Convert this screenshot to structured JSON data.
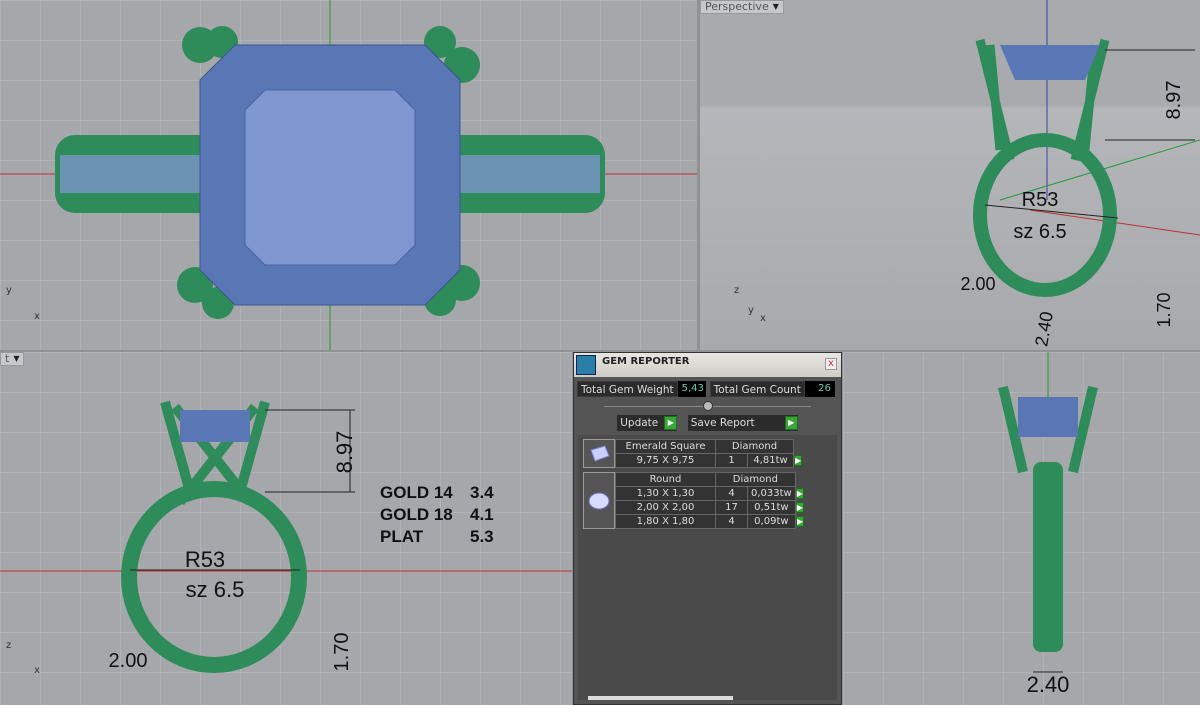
{
  "viewports": {
    "top": {
      "axis_x": "x",
      "axis_y": "y"
    },
    "perspective": {
      "label": "Perspective",
      "dims": {
        "height": "8.97",
        "ring_size": "R53",
        "sz": "sz 6.5",
        "shank_left": "2.00",
        "bottom": "2.40",
        "side": "1.70"
      },
      "axis_x": "x",
      "axis_y": "y",
      "axis_z": "z"
    },
    "front": {
      "label": "t",
      "dims": {
        "height": "8.97",
        "ring_size": "R53",
        "sz": "sz 6.5",
        "shank_left": "2.00",
        "side": "1.70"
      },
      "axis_x": "x",
      "axis_z": "z",
      "metals": [
        {
          "name": "GOLD  14",
          "weight": "3.4"
        },
        {
          "name": "GOLD  18",
          "weight": "4.1"
        },
        {
          "name": "PLAT",
          "weight": "5.3"
        }
      ]
    },
    "right": {
      "dims": {
        "bottom": "2.40"
      }
    }
  },
  "gem_reporter": {
    "title": "GEM REPORTER",
    "close": "x",
    "total_weight_label": "Total Gem Weight",
    "total_weight": "5,43",
    "total_count_label": "Total Gem Count",
    "total_count": "26",
    "update_label": "Update",
    "save_label": "Save Report",
    "groups": [
      {
        "shape": "Emerald Square",
        "material": "Diamond",
        "icon": "emerald-gem-icon",
        "rows": [
          {
            "size": "9,75 X 9,75",
            "count": "1",
            "weight": "4,81tw"
          }
        ]
      },
      {
        "shape": "Round",
        "material": "Diamond",
        "icon": "round-gem-icon",
        "rows": [
          {
            "size": "1,30 X 1,30",
            "count": "4",
            "weight": "0,033tw"
          },
          {
            "size": "2,00 X 2,00",
            "count": "17",
            "weight": "0,51tw"
          },
          {
            "size": "1,80 X 1,80",
            "count": "4",
            "weight": "0,09tw"
          }
        ]
      }
    ],
    "colors": {
      "ring_metal": "#2e8b5a",
      "gem": "#6d86c0",
      "panel": "#545454",
      "value_text": "#6ec9b0",
      "button_go": "#3aa63a"
    }
  }
}
